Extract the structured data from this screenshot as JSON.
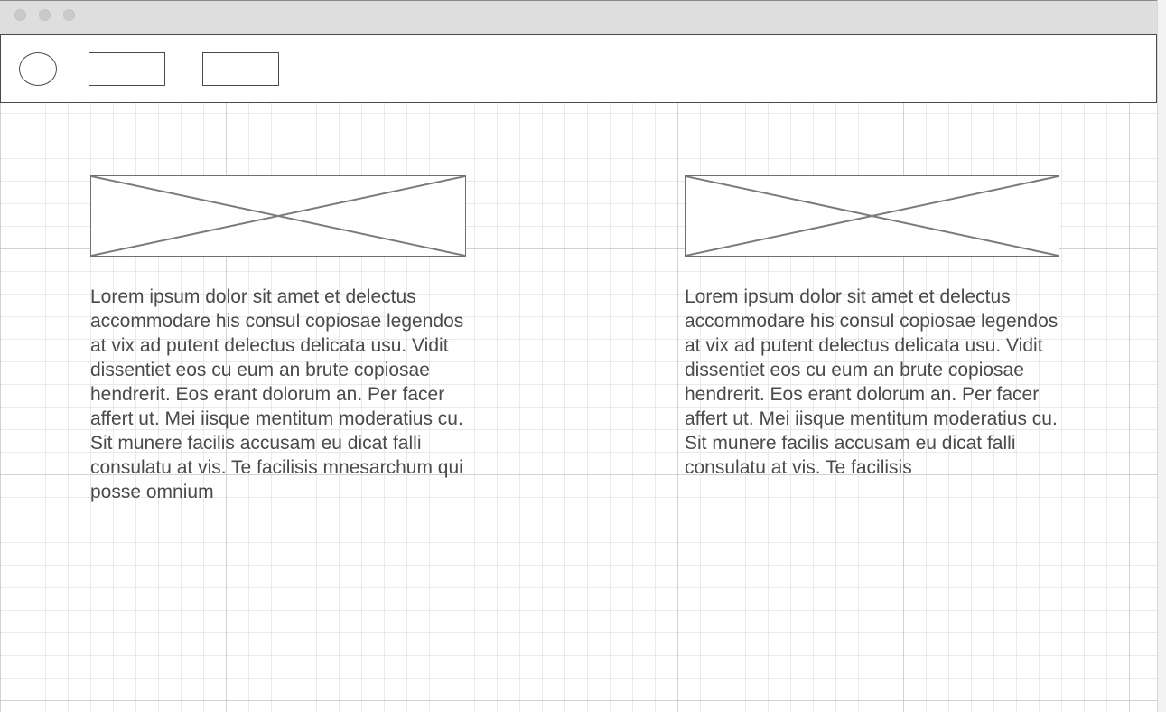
{
  "window": {
    "traffic_lights": [
      "close",
      "minimize",
      "maximize"
    ]
  },
  "navbar": {
    "logo": "circle-placeholder",
    "buttons": [
      "",
      ""
    ]
  },
  "cards": [
    {
      "image": "image-placeholder",
      "text": "Lorem ipsum dolor sit amet et delectus accommodare his consul copiosae legendos at vix ad putent delectus delicata usu. Vidit dissentiet eos cu eum an brute copiosae hendrerit. Eos erant dolorum an. Per facer affert ut. Mei iisque mentitum moderatius cu. Sit munere facilis accusam eu dicat falli consulatu at vis. Te facilisis mnesarchum qui posse omnium"
    },
    {
      "image": "image-placeholder",
      "text": "Lorem ipsum dolor sit amet et delectus accommodare his consul copiosae legendos at vix ad putent delectus delicata usu. Vidit dissentiet eos cu eum an brute copiosae hendrerit. Eos erant dolorum an. Per facer affert ut. Mei iisque mentitum moderatius cu. Sit munere facilis accusam eu dicat falli consulatu at vis. Te facilisis"
    }
  ],
  "colors": {
    "outline": "#4a4a4a",
    "text": "#4a4a4a",
    "titlebar": "#dedede",
    "grid": "#e1e1e1"
  }
}
